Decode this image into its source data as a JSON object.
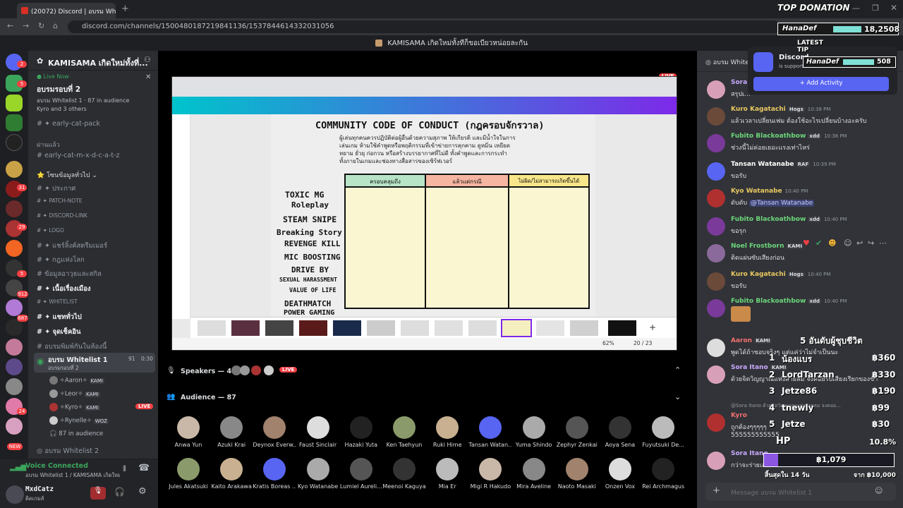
{
  "browser": {
    "tab_title": "(20072) Discord | อบรม Whitelist 1 | KAMI...",
    "url": "discord.com/channels/1500480187219841136/1537844614332031056",
    "window_title": "KAMISAMA เกิดใหม่ทั้งทีก็ขอเบียวหน่อยละกัน"
  },
  "server": {
    "name": "KAMISAMA เกิดใหม่ทั้งที่...",
    "live_now": "Live Now",
    "stage_name": "อบรมรอบที่ 2",
    "stage_sub": "อบรม Whitelist 1 · 87 in audience",
    "stage_users": "Kyro and 3 others"
  },
  "rail_badges": [
    "2",
    "5",
    "31",
    "29",
    "5",
    "912",
    "687",
    "24",
    "NEW"
  ],
  "channels": [
    {
      "label": "early-cat-pack",
      "type": "text"
    },
    {
      "label": "ผ่านแล้ว",
      "type": "category"
    },
    {
      "label": "early-cat-m-x-d-c-a-t-z",
      "type": "text"
    },
    {
      "label": "โซนข้อมูลทั่วไป",
      "type": "category"
    },
    {
      "label": "ประกาศ",
      "type": "text"
    },
    {
      "label": "PATCH-NOTE",
      "type": "text"
    },
    {
      "label": "DISCORD-LINK",
      "type": "text"
    },
    {
      "label": "LOGO",
      "type": "text"
    },
    {
      "label": "แชร์ลิ้งค์สตรีมเมอร์",
      "type": "text"
    },
    {
      "label": "กฎแห่งโลก",
      "type": "text"
    },
    {
      "label": "ข้อมูลอาวุธและสกิล",
      "type": "text"
    },
    {
      "label": "เนื้อเรื่องเมือง",
      "type": "text"
    },
    {
      "label": "WHITELIST",
      "type": "text"
    },
    {
      "label": "แชททั่วไป",
      "type": "text"
    },
    {
      "label": "จุดเช็คอิน",
      "type": "text"
    },
    {
      "label": "อบรมพิมพ์กันในห้องนี้",
      "type": "text"
    }
  ],
  "voice_channel": {
    "name": "อบรม Whitelist 1",
    "sub": "อบรมรอบที่ 2",
    "count": "91",
    "time": "0:30",
    "users": [
      {
        "name": "Aaron",
        "tag": "KAMI"
      },
      {
        "name": "Leor",
        "tag": "KAMI"
      },
      {
        "name": "Kyro",
        "tag": "KAMI",
        "live": "LIVE"
      },
      {
        "name": "Rynelle",
        "tag": "WOZ"
      }
    ],
    "audience": "87 in audience",
    "next": "อบรม Whitelist 2"
  },
  "voice_panel": {
    "title": "Voice Connected",
    "sub": "อบรม Whitelist 1 / KAMISAMA เกิดใหม่ทั้ง..."
  },
  "user_panel": {
    "name": "MxdCatz",
    "status": "ติดเกมส์"
  },
  "screen": {
    "title": "COMMUNITY CODE OF CONDUCT (กฎครอบจักรวาล)",
    "intro": [
      "ผู้เล่นทุกคนควรปฏิบัติต่อผู้อื่นด้วยความสุภาพ ให้เกียรติ และมีน้ำใจในการ",
      "เล่นเกม ห้ามใช้คำพูดหรือพฤติกรรมที่เข้าข่ายการคุกคาม ดูหมิ่น เหยียด",
      "หยาม ยั่วยุ ก่อกวน หรือสร้างบรรยากาศที่ไม่ดี ทั้งคำพูดและการกระทำ",
      "ทั้งภายในเกมและช่องทางสื่อสารของเซิร์ฟเวอร์"
    ],
    "col_headers": [
      "ครอบคลุมถึง",
      "แล้วแต่กรณี",
      "ไม่ผิด/ไม่สามารถเกิดขึ้นได้"
    ],
    "rules": [
      "TOXIC    MG",
      "Roleplay",
      "STEAM SNIPE",
      "Breaking Story",
      "REVENGE KILL",
      "MIC BOOSTING",
      "DRIVE BY",
      "SEXUAL HARASSMENT",
      "VALUE OF LIFE",
      "DEATHMATCH",
      "POWER GAMING"
    ],
    "page": "20 / 23",
    "zoom": "62%",
    "live": "LIVE"
  },
  "speakers": {
    "label": "Speakers — 4",
    "live": "LIVE"
  },
  "audience": {
    "label": "Audience — 87",
    "row1": [
      "Anwa Yun",
      "Azuki Krai",
      "Deynox Everw...",
      "Faust Sinclair",
      "Hazaki Yuta",
      "Ken Taehyun",
      "Ruki Hime",
      "Tansan Watan...",
      "Yuma Shindo",
      "Zephyr Zenkai",
      "Aoya Sena",
      "Fuyutsuki De..."
    ],
    "row2": [
      "Jules Akatsuki",
      "Kaito Arakawa",
      "Kratis Boreas ...",
      "Kyo Watanabe",
      "Lumiel Aureli...",
      "Meenoi Kaguya",
      "Mia Er",
      "Migi R Hakudo",
      "Mira Aveline",
      "Naoto Masaki",
      "Onzen Vox",
      "Rei Archmagus"
    ]
  },
  "chat": {
    "header": "อบรม Whitelist 1",
    "messages": [
      {
        "user": "Sora Itano",
        "time": "",
        "text": "สรุปเ...",
        "color": "#c8a8ff"
      },
      {
        "user": "Kuro Kagatachi",
        "tag": "Hogs",
        "time": "10:38 PM",
        "text": "แล้วเวลาเปลี่ยนเฟม ต้องใช้อะไรเปลี่ยนบ้างอะครับ",
        "color": "#e8c860"
      },
      {
        "user": "Fubito Blackoathbow",
        "tag": "xdd",
        "time": "10:38 PM",
        "text": "ช่วงนี้ไม่ค่อยเยอะแรงเท่าไหร่",
        "color": "#6cd67a"
      },
      {
        "user": "Tansan Watanabe",
        "tag": "RAF",
        "time": "10:39 PM",
        "text": "ขอรับ",
        "color": "#ffffff"
      },
      {
        "user": "Kyo Watanabe",
        "time": "10:40 PM",
        "text": "ดับดับ",
        "mention": "@Tansan Watanabe",
        "color": "#e8c860"
      },
      {
        "user": "Fubito Blackoathbow",
        "tag": "xdd",
        "time": "10:40 PM",
        "text": "ขอรุก",
        "color": "#6cd67a"
      },
      {
        "user": "Noel Frostborn",
        "tag": "KAMI",
        "time": "",
        "text": "ติดแผ่นซับเสียงก่อน",
        "color": "#6cd67a"
      },
      {
        "user": "Kuro Kagatachi",
        "tag": "Hogs",
        "time": "10:40 PM",
        "text": "ขอรับ",
        "color": "#e8c860"
      },
      {
        "user": "Fubito Blackoathbow",
        "tag": "xdd",
        "time": "10:40 PM",
        "text": "",
        "color": "#6cd67a"
      },
      {
        "user": "Aaron",
        "tag": "KAMI",
        "time": "",
        "text": "พูดได้ถ้าชอบจริงๆ แต่แค่ว่าไม่จำเป็นนะ",
        "color": "#f27070"
      },
      {
        "user": "Sora Itano",
        "tag": "KAMI",
        "time": "",
        "text": "ด้วยจิตวิญญาณแห่งสายลม จงคอยรับเสียงเรียกของข้า",
        "color": "#c8a8ff"
      },
      {
        "user": "Kyro",
        "time": "",
        "text": "ถูกต้องๆๆๆๆๆ",
        "extra": "555555555555",
        "color": "#f27070"
      },
      {
        "user": "Sora Itano",
        "time": "",
        "text": "กว่าจะร่ายเส...",
        "color": "#c8a8ff"
      }
    ],
    "reply_ref": "@Sora Itano ด้วยจิตวิญญาณแห่งสายลม จงคอย...",
    "input_placeholder": "Message อบรม Whitelist 1"
  },
  "activity_popup": {
    "title": "Discord",
    "sub": "is supported",
    "button": "Add Activity"
  },
  "overlay": {
    "top_donation": "TOP DONATION",
    "top_name": "HanaDef",
    "top_amount": "18,2508",
    "latest_tip": "LATEST TIP",
    "tip_name": "HanaDef",
    "tip_amount": "508",
    "rank_title": "5 อันดับผู้ชุบชีวิต",
    "ranks": [
      {
        "rank": "1",
        "name": "น้องแบร",
        "amount": "฿360"
      },
      {
        "rank": "2",
        "name": "LordTarzan",
        "amount": "฿330"
      },
      {
        "rank": "3",
        "name": "Jetze86",
        "amount": "฿190"
      },
      {
        "rank": "4",
        "name": "tnewly",
        "amount": "฿99"
      },
      {
        "rank": "5",
        "name": "Jetze",
        "amount": "฿30"
      }
    ],
    "hp_label": "HP",
    "hp_pct": "10.8%",
    "hp_fill": 0.108,
    "hp_value": "฿1,079",
    "days_left": "สิ้นสุดใน 14 วัน",
    "goal": "จาก ฿10,000"
  }
}
